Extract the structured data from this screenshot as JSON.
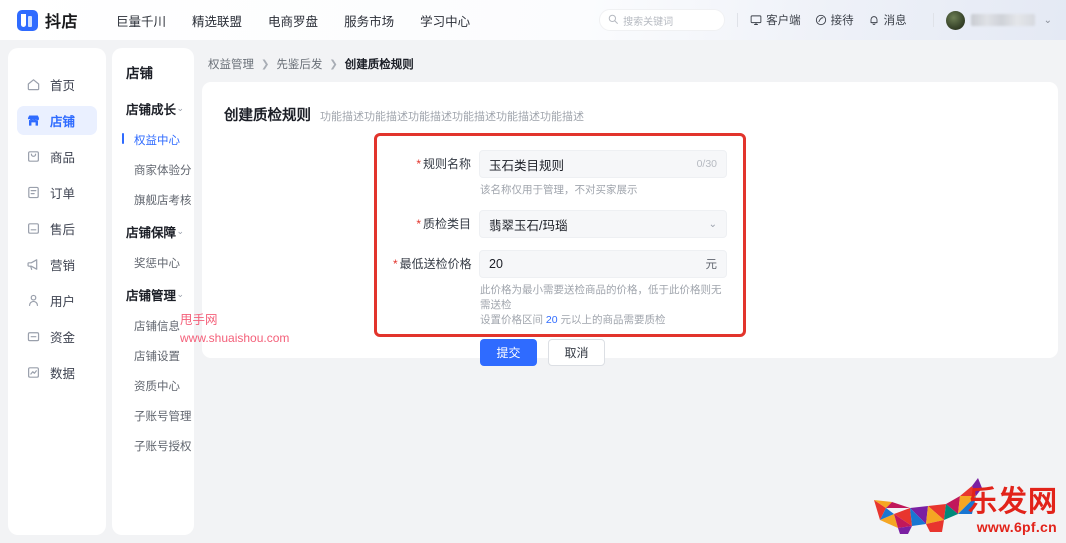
{
  "header": {
    "logo_text": "抖店",
    "nav": [
      {
        "label": "巨量千川"
      },
      {
        "label": "精选联盟"
      },
      {
        "label": "电商罗盘"
      },
      {
        "label": "服务市场"
      },
      {
        "label": "学习中心"
      }
    ],
    "search_placeholder": "搜索关键词",
    "actions": [
      {
        "label": "客户端",
        "icon": "monitor-icon"
      },
      {
        "label": "接待",
        "icon": "headset-icon"
      },
      {
        "label": "消息",
        "icon": "bell-icon"
      }
    ],
    "user_name": ""
  },
  "rail": {
    "items": [
      {
        "label": "首页",
        "icon": "home-icon",
        "active": false
      },
      {
        "label": "店铺",
        "icon": "shop-icon",
        "active": true
      },
      {
        "label": "商品",
        "icon": "goods-icon",
        "active": false
      },
      {
        "label": "订单",
        "icon": "order-icon",
        "active": false
      },
      {
        "label": "售后",
        "icon": "aftersale-icon",
        "active": false
      },
      {
        "label": "营销",
        "icon": "megaphone-icon",
        "active": false
      },
      {
        "label": "用户",
        "icon": "user-icon",
        "active": false
      },
      {
        "label": "资金",
        "icon": "fund-icon",
        "active": false
      },
      {
        "label": "数据",
        "icon": "chart-icon",
        "active": false
      }
    ]
  },
  "submenu": {
    "title": "店铺",
    "groups": [
      {
        "label": "店铺成长",
        "items": [
          {
            "label": "权益中心",
            "active": true
          },
          {
            "label": "商家体验分",
            "active": false
          },
          {
            "label": "旗舰店考核",
            "active": false
          }
        ]
      },
      {
        "label": "店铺保障",
        "items": [
          {
            "label": "奖惩中心",
            "active": false
          }
        ]
      },
      {
        "label": "店铺管理",
        "items": [
          {
            "label": "店铺信息",
            "active": false
          },
          {
            "label": "店铺设置",
            "active": false
          },
          {
            "label": "资质中心",
            "active": false
          },
          {
            "label": "子账号管理",
            "active": false
          },
          {
            "label": "子账号授权",
            "active": false
          }
        ]
      }
    ]
  },
  "breadcrumb": {
    "first": "权益管理",
    "second": "先鉴后发",
    "current": "创建质检规则",
    "sep": "〉"
  },
  "card": {
    "title": "创建质检规则",
    "description": "功能描述功能描述功能描述功能描述功能描述功能描述"
  },
  "form": {
    "rule_name": {
      "label": "规则名称",
      "value": "玉石类目规则",
      "counter": "0/30",
      "hint": "该名称仅用于管理，不对买家展示"
    },
    "category": {
      "label": "质检类目",
      "value": "翡翠玉石/玛瑙"
    },
    "min_price": {
      "label": "最低送检价格",
      "value": "20",
      "unit": "元",
      "hint_line1": "此价格为最小需要送检商品的价格，低于此价格则无需送检",
      "hint_line2_pre": "设置价格区间 ",
      "hint_line2_num": "20",
      "hint_line2_post": " 元以上的商品需要质检"
    },
    "submit_label": "提交",
    "cancel_label": "取消"
  },
  "watermarks": {
    "shuaishou_name": "甩手网",
    "shuaishou_url": "www.shuaishou.com",
    "logo_cn": "乐发网",
    "logo_url": "www.6pf.cn"
  },
  "colors": {
    "accent": "#2f6bff",
    "highlight_border": "#e2342c",
    "page_bg": "#f2f3f5",
    "watermark_pink": "#f4607a",
    "watermark_red": "#e2231a"
  }
}
